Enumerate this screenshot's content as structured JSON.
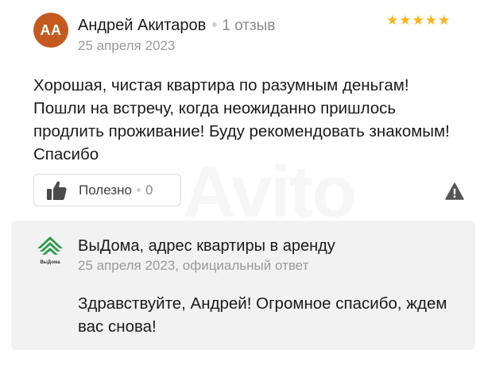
{
  "watermark": "Avito",
  "review": {
    "avatar_initials": "АА",
    "author": "Андрей Акитаров",
    "reviews_count": "1 отзыв",
    "date": "25 апреля 2023",
    "rating": 5,
    "stars": "★★★★★",
    "text": "Хорошая, чистая квартира по разумным деньгам! Пошли на встречу, когда неожиданно пришлось продлить проживание! Буду рекомендовать знакомым! Спасибо",
    "useful_label": "Полезно",
    "useful_count": "0"
  },
  "reply": {
    "company": "ВыДома, адрес квартиры в аренду",
    "logo_text": "ВыДома",
    "meta": "25 апреля 2023, официальный ответ",
    "text": "Здравствуйте, Андрей! Огромное спасибо, ждем вас снова!"
  },
  "colors": {
    "avatar_bg": "#c45a20",
    "stars": "#ffb31a",
    "reply_bg": "#f2f2f2",
    "logo_green": "#2e9b4f"
  },
  "icons": [
    "thumbs-up-icon",
    "warning-icon",
    "company-logo"
  ]
}
